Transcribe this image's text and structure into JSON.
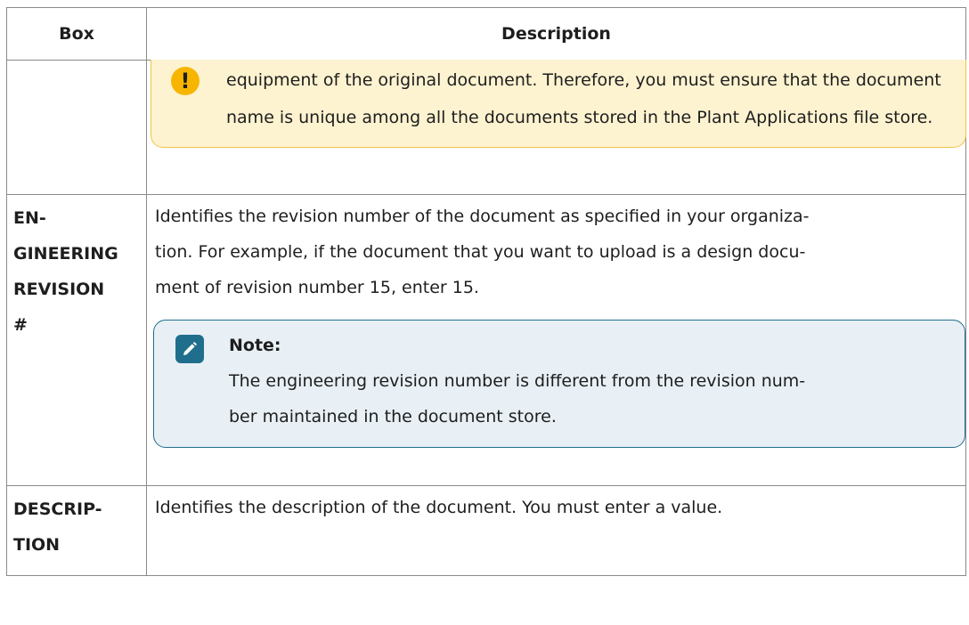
{
  "table": {
    "headers": [
      "Box",
      "Description"
    ],
    "rows": [
      {
        "box": "",
        "warning_text": "equipment of the original document. Therefore, you must ensure that the document name is unique among all the documents stored in the Plant Applications file store.",
        "warning_icon": "exclamation-icon"
      },
      {
        "box": "EN-GINEERING REVISION #",
        "box_lines": [
          "EN-",
          "GINEERING",
          "REVISION",
          "#"
        ],
        "description": "Identifies the revision number of the document as specified in your organiza-tion. For example, if the document that you want to upload is a design docu-ment of revision number 15, enter 15.",
        "description_lines": [
          "Identifies the revision number of the document as specified in your organiza-",
          "tion. For example, if the document that you want to upload is a design docu-",
          "ment of revision number 15, enter 15."
        ],
        "note": {
          "title": "Note:",
          "icon": "pencil-icon",
          "lines": [
            "The engineering revision number is different from the revision num-",
            "ber maintained in the document store."
          ]
        }
      },
      {
        "box_lines": [
          "DESCRIP-",
          "TION"
        ],
        "description": "Identifies the description of the document. You must enter a value."
      }
    ]
  },
  "colors": {
    "warning_bg": "#fdf3d0",
    "warning_border": "#f0c44a",
    "warning_icon": "#f7b500",
    "note_bg": "#e8f0f5",
    "note_border": "#1f6e8c"
  }
}
